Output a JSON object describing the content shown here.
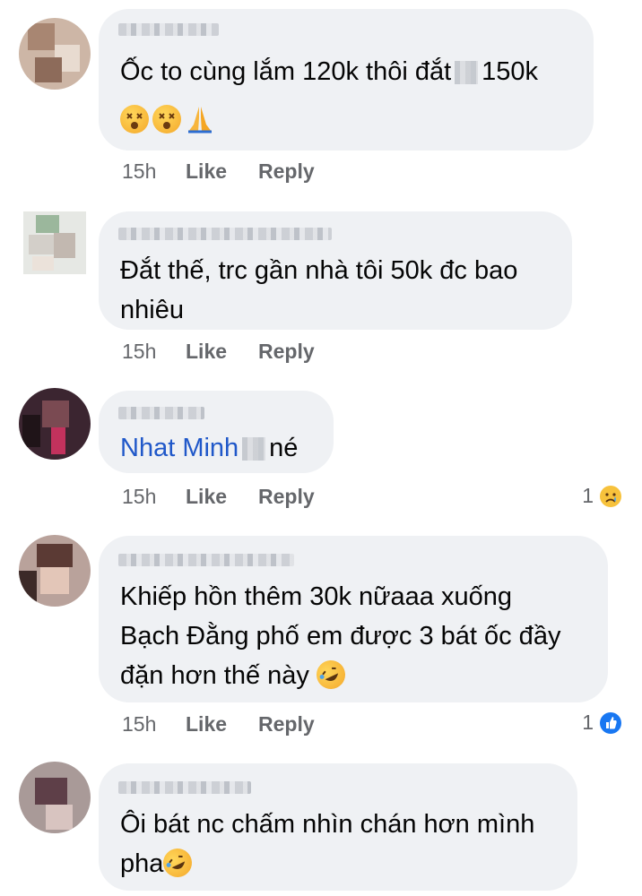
{
  "comments": [
    {
      "author_blurred": true,
      "text_parts": [
        "Ốc to cùng lắm 120k thôi đắt",
        "150k"
      ],
      "emojis": [
        "dizzy-face",
        "dizzy-face",
        "folded-hands"
      ],
      "time": "15h",
      "like": "Like",
      "reply": "Reply"
    },
    {
      "author_blurred": true,
      "line1": "Đắt thế, trc gần nhà tôi 50k đc bao",
      "line2": "nhiêu",
      "time": "15h",
      "like": "Like",
      "reply": "Reply"
    },
    {
      "author_blurred": true,
      "mention": "Nhat Minh",
      "text_after": "né",
      "time": "15h",
      "like": "Like",
      "reply": "Reply",
      "reaction_count": "1",
      "reaction": "sad"
    },
    {
      "author_blurred": true,
      "line1": "Khiếp hồn thêm 30k nữaaa xuống",
      "line2": "Bạch Đằng phố em được 3 bát ốc đầy",
      "line3": "đặn hơn thế này",
      "emoji": "rolling-on-floor-laughing",
      "time": "15h",
      "like": "Like",
      "reply": "Reply",
      "reaction_count": "1",
      "reaction": "like"
    },
    {
      "author_blurred": true,
      "line1": "Ôi bát nc chấm nhìn chán hơn mình",
      "line2": "pha",
      "emoji": "rolling-on-floor-laughing"
    }
  ],
  "colors": {
    "bubble": "#eff1f4",
    "meta": "#65676b",
    "mention": "#2058c9",
    "like_blue": "#1877f2"
  }
}
